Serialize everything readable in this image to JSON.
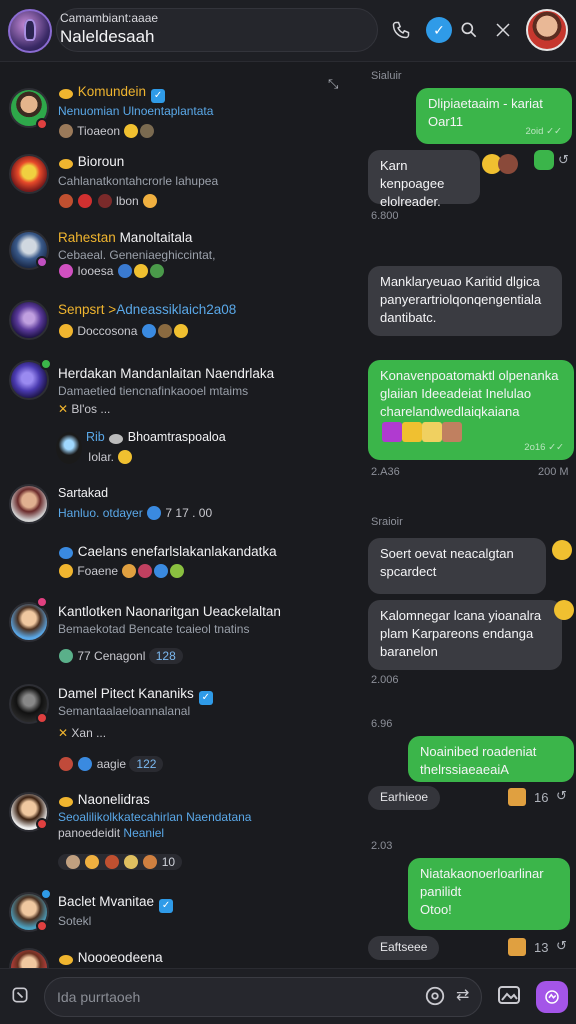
{
  "header": {
    "subtitle": "Camambiant:aaae",
    "title": "Naleldesaah"
  },
  "chat_list": [
    {
      "name_tag": "Komundein",
      "name_rest": "",
      "sub": "Nenuomian Ulnoentaplantata",
      "meta": "Tioaeon"
    },
    {
      "name_tag": "Bioroun",
      "name_rest": "",
      "sub": "Cahlanatkontahcrorle lahupea",
      "meta": "lbon"
    },
    {
      "name_tag": "Rahestan",
      "name_rest": "Manoltaitala",
      "sub": "Cebaeal. Geneniaeghiccintat,",
      "meta": "Iooesa"
    },
    {
      "name_tag": "Senpsrt",
      "name_rest": "Adneassiklaich2a08",
      "meta": "Doccosona"
    },
    {
      "name_tag": "",
      "name_rest": "Herdakan Mandanlaitan Naendrlaka",
      "sub": "Damaetied tiencnafinkaooel mtaims",
      "meta": "Bl'os ..."
    },
    {
      "name_tag": "",
      "name_rest": "Bhoamtraspoaloa",
      "meta": "Iolar."
    },
    {
      "name_tag": "",
      "name_rest": "Sartakad",
      "sub": "Hanluo. otdayer",
      "meta": "7 17 . 00"
    },
    {
      "name_tag": "",
      "name_rest": "Caelans enefarlslakanlakandatka",
      "meta": "Foaene"
    },
    {
      "name_tag": "",
      "name_rest": "Kantlotken Naonaritgan Ueackelaltan",
      "sub": "Bemaekotad Bencate tcaieol tnatins",
      "meta": "77 Cenagonl",
      "pill": "128"
    },
    {
      "name_tag": "",
      "name_rest": "Damel Pitect Kananiks",
      "sub": "Semantaalaeloannalanal",
      "meta": "Xan ..."
    },
    {
      "name_tag": "",
      "name_rest": "",
      "meta": "aagie",
      "pill": "122"
    },
    {
      "name_tag": "",
      "name_rest": "Naonelidras",
      "sub": "Seoalilikolkkatecahirlan Naendatana",
      "sub2_a": "panoedeidit",
      "sub2_b": "Neaniel",
      "meta": "10"
    },
    {
      "name_tag": "",
      "name_rest": "Baclet Mvanitae",
      "sub": "Sotekl"
    },
    {
      "name_tag": "",
      "name_rest": "Noooeodeena"
    }
  ],
  "conversation": {
    "day1": "Sialuir",
    "day2": "Sraioir",
    "day3": "2.03",
    "day4": "6.96",
    "day5": "2.08",
    "time_a": "6.800",
    "time_b": "2.A36",
    "time_c": "200 M",
    "time_d": "2.006",
    "msg1": "Dlipiaetaaim - kariat\nOar11",
    "msg2": "Karn kenpoagee\nelolreader.",
    "msg3": "Manklaryeuao Karitid dlgica\npanyerartriolqonqengentiala\ndantibatc.",
    "msg4": "Konavenpoatomaktl olpenanka\nglaiian Ideeadeiat Inelulao\ncharelandwedlaiqkaiana",
    "msg5": "Soert oevat neacalgtan\nspcardect",
    "msg6": "Kalomnegar lcana yioanalra\nplam Karpareons endanga\nbaranelon",
    "msg7": "Noainibed roadeniat\nthelrssiaeaeaiA",
    "msg8": "Niatakaonoerloarlinar\npanilidt\nOtoo!",
    "small1": "Earhieoe",
    "small2": "Eaftseee",
    "count1": "16",
    "count2": "13",
    "read1": "2oid ✓✓",
    "read2": "2o16 ✓✓"
  },
  "composer": {
    "placeholder": "Ida purrtaoeh"
  }
}
